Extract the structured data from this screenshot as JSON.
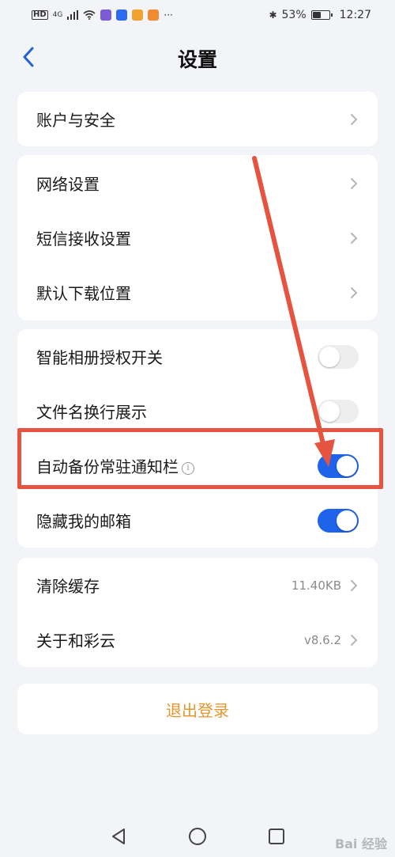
{
  "status_bar": {
    "network_left": "HD",
    "signal_type": "4G",
    "bluetooth": "✱",
    "battery_percent": "53%",
    "battery_level": 0.53,
    "time": "12:27",
    "more": "···"
  },
  "header": {
    "title": "设置",
    "back_icon": "chevron-left-icon"
  },
  "groups": [
    {
      "items": [
        {
          "label": "账户与安全",
          "type": "nav"
        }
      ]
    },
    {
      "items": [
        {
          "label": "网络设置",
          "type": "nav"
        },
        {
          "label": "短信接收设置",
          "type": "nav"
        },
        {
          "label": "默认下载位置",
          "type": "nav"
        }
      ]
    },
    {
      "items": [
        {
          "label": "智能相册授权开关",
          "type": "toggle",
          "on": false
        },
        {
          "label": "文件名换行展示",
          "type": "toggle",
          "on": false
        },
        {
          "label": "自动备份常驻通知栏",
          "type": "toggle",
          "on": true,
          "info": true
        },
        {
          "label": "隐藏我的邮箱",
          "type": "toggle",
          "on": true
        }
      ]
    },
    {
      "items": [
        {
          "label": "清除缓存",
          "type": "nav",
          "value": "11.40KB"
        },
        {
          "label": "关于和彩云",
          "type": "nav",
          "value": "v8.6.2"
        }
      ]
    }
  ],
  "logout": {
    "label": "退出登录"
  },
  "colors": {
    "accent": "#1e63e9",
    "logout": "#e8962b",
    "annotation": "#e5543f",
    "background": "#f3f4f8"
  },
  "info_glyph": "i",
  "watermark": "Bai 经验"
}
